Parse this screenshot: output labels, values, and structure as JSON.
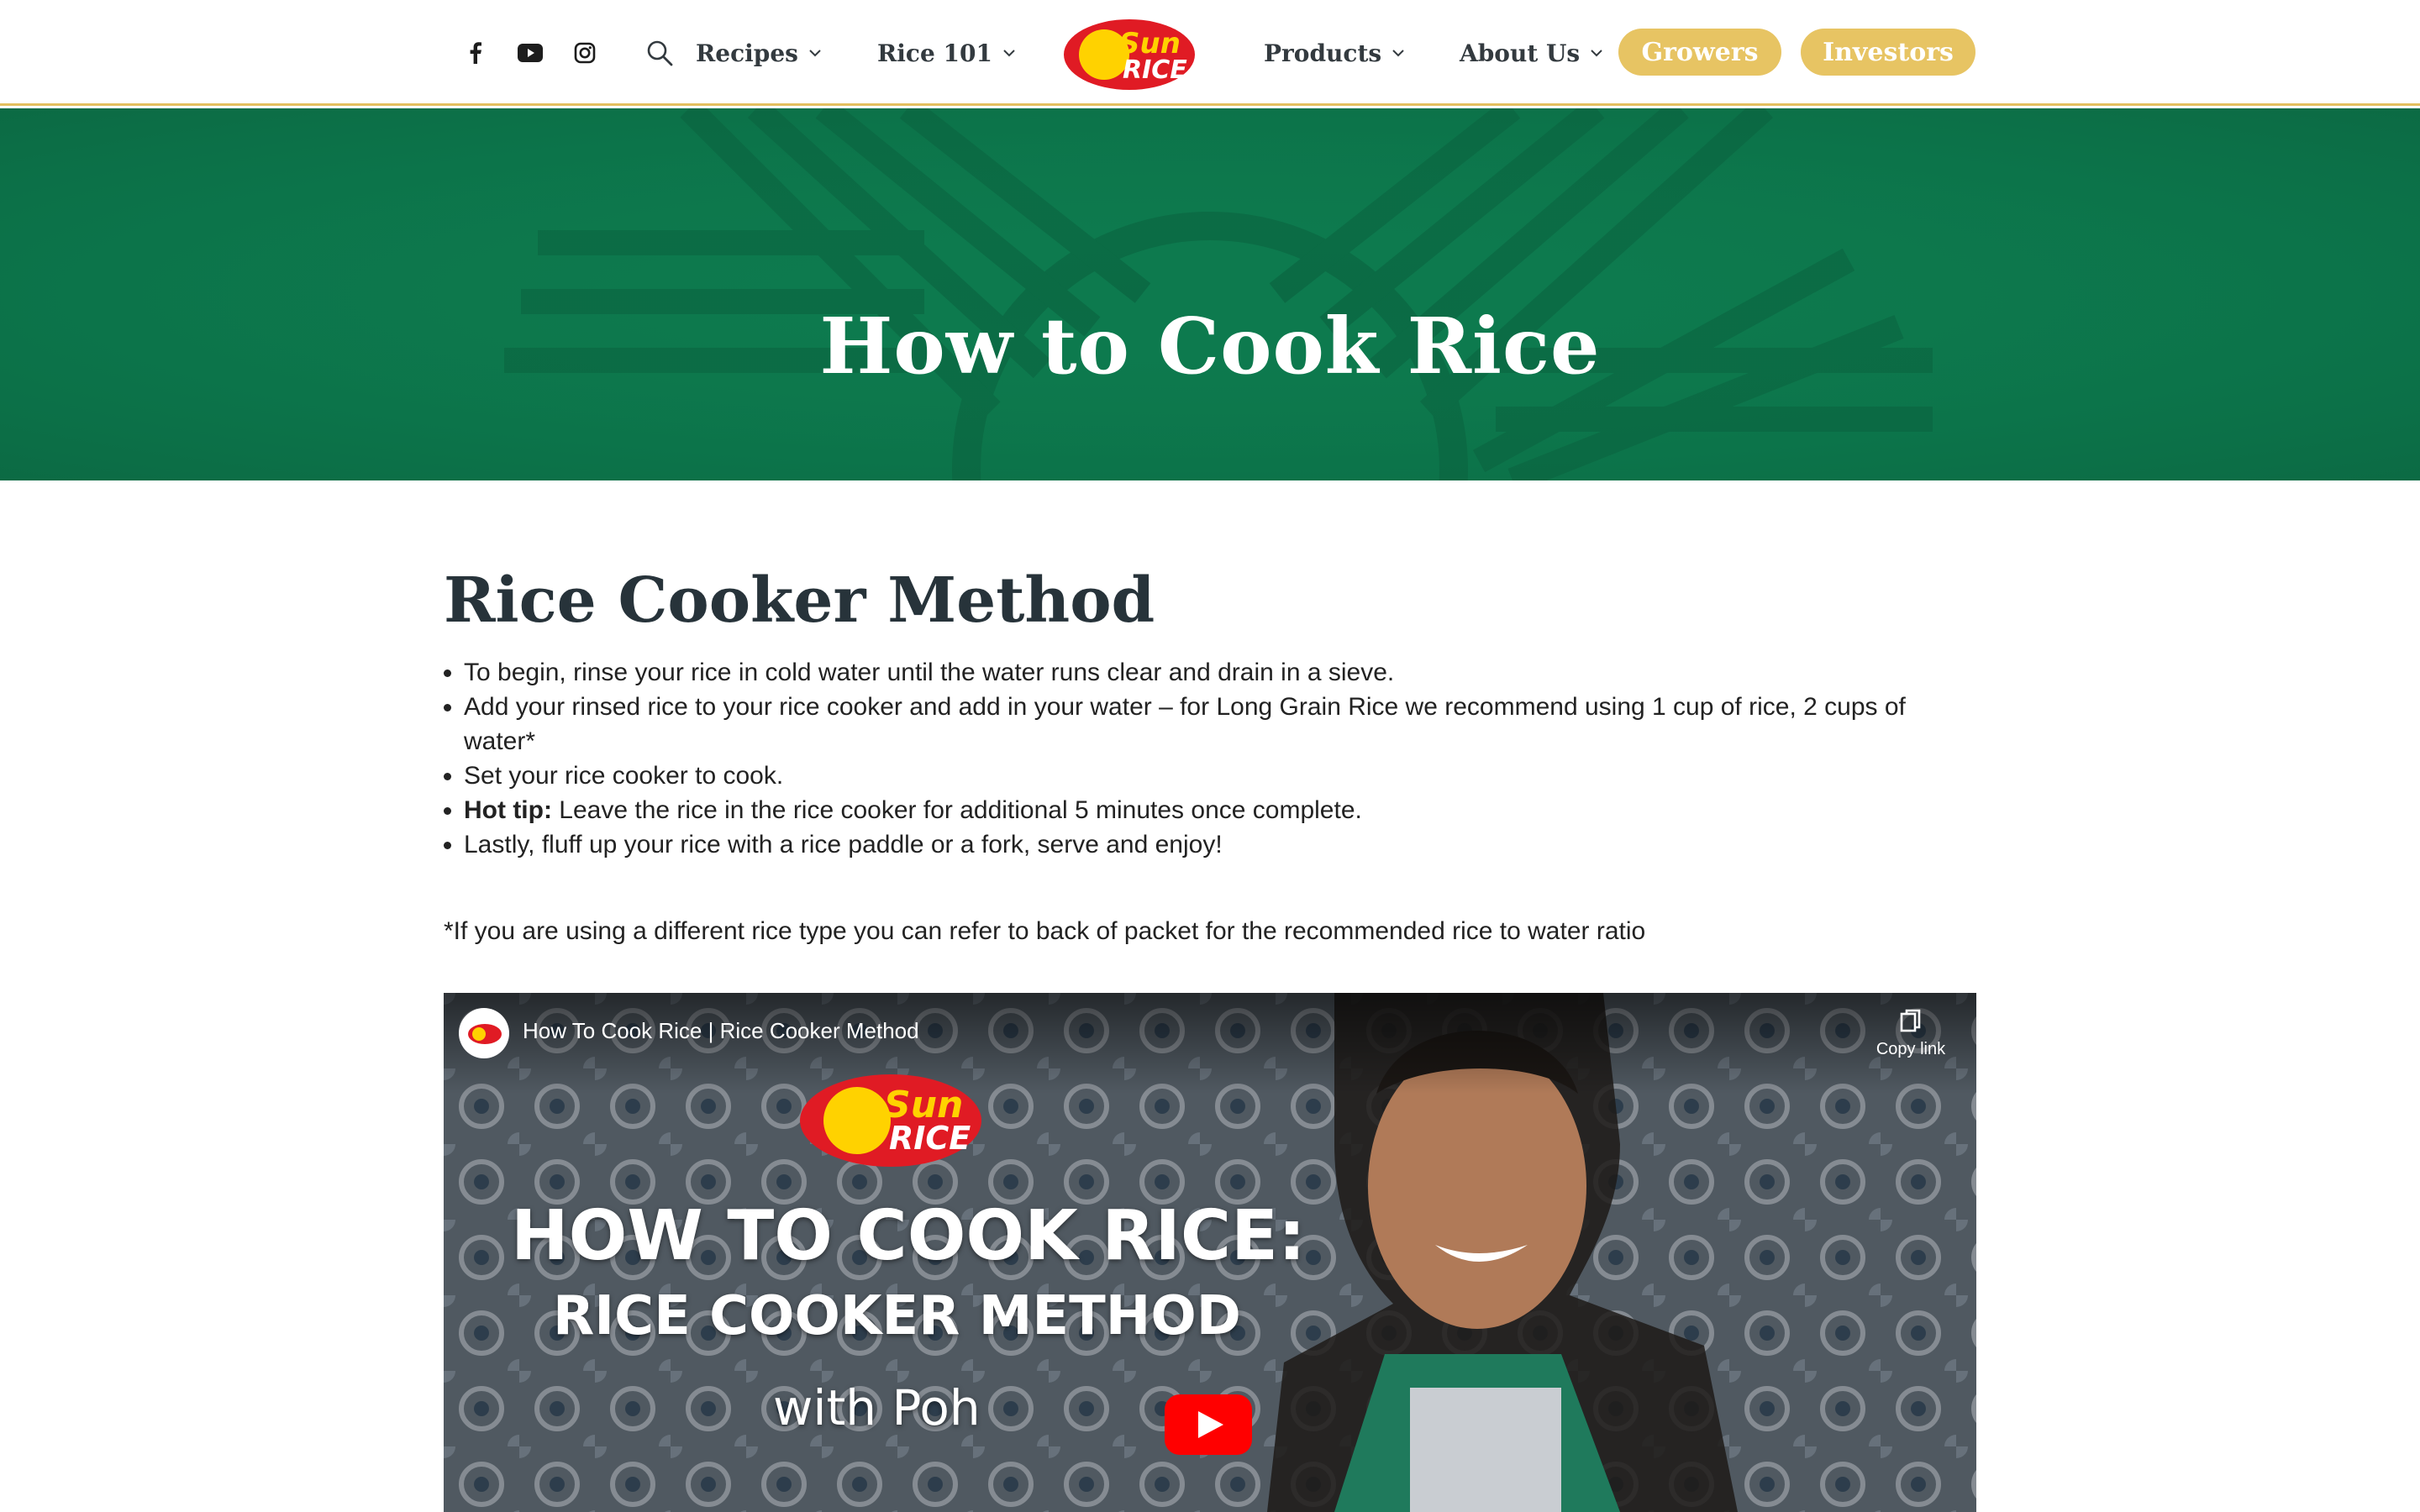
{
  "header": {
    "social": [
      {
        "icon": "facebook-icon"
      },
      {
        "icon": "youtube-icon"
      },
      {
        "icon": "instagram-icon"
      }
    ],
    "search_icon": "search-icon",
    "nav_left": [
      {
        "label": "Recipes"
      },
      {
        "label": "Rice 101"
      }
    ],
    "logo": {
      "line1": "Sun",
      "line2": "RICE"
    },
    "nav_right": [
      {
        "label": "Products"
      },
      {
        "label": "About Us"
      }
    ],
    "buttons": [
      {
        "label": "Growers"
      },
      {
        "label": "Investors"
      }
    ]
  },
  "hero": {
    "title": "How to Cook Rice"
  },
  "section": {
    "title": "Rice Cooker Method",
    "steps": [
      {
        "bold": "",
        "text": "To begin, rinse your rice in cold water until the water runs clear and drain in a sieve."
      },
      {
        "bold": "",
        "text": "Add your rinsed rice to your rice cooker and add in your water – for Long Grain Rice we recommend using 1 cup of rice, 2 cups of water*"
      },
      {
        "bold": "",
        "text": "Set your rice cooker to cook."
      },
      {
        "bold": "Hot tip:",
        "text": " Leave the rice in the rice cooker for additional 5 minutes once complete."
      },
      {
        "bold": "",
        "text": "Lastly, fluff up your rice with a rice paddle or a fork, serve and enjoy!"
      }
    ],
    "note": "*If you are using a different rice type you can refer to back of packet for the recommended rice to water ratio"
  },
  "video": {
    "title": "How To Cook Rice | Rice Cooker Method",
    "copy_link": "Copy link",
    "thumb_line1": "HOW TO COOK RICE:",
    "thumb_line2": "RICE COOKER METHOD",
    "thumb_line3": "with Poh",
    "logo": {
      "line1": "Sun",
      "line2": "RICE"
    }
  },
  "colors": {
    "hero_green": "#0d7a4e",
    "accent_gold": "#e7c463",
    "logo_red": "#e01b24",
    "logo_yellow": "#ffd200",
    "youtube_red": "#ff0000"
  }
}
